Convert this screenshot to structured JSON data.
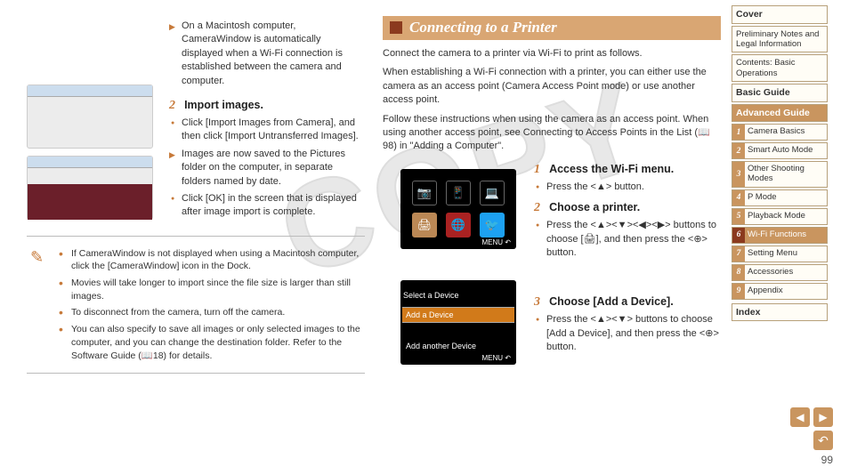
{
  "watermark": "COPY",
  "left": {
    "intro_play": "On a Macintosh computer, CameraWindow is automatically displayed when a Wi-Fi connection is established between the camera and computer.",
    "step2_num": "2",
    "step2_title": "Import images.",
    "step2_b1": "Click [Import Images from Camera], and then click [Import Untransferred Images].",
    "step2_b2": "Images are now saved to the Pictures folder on the computer, in separate folders named by date.",
    "step2_b3": "Click [OK] in the screen that is displayed after image import is complete.",
    "notes": [
      "If CameraWindow is not displayed when using a Macintosh computer, click the [CameraWindow] icon in the Dock.",
      "Movies will take longer to import since the file size is larger than still images.",
      "To disconnect from the camera, turn off the camera.",
      "You can also specify to save all images or only selected images to the computer, and you can change the destination folder. Refer to the Software Guide (📖18) for details."
    ]
  },
  "right": {
    "title": "Connecting to a Printer",
    "intro1": "Connect the camera to a printer via Wi-Fi to print as follows.",
    "intro2": "When establishing a Wi-Fi connection with a printer, you can either use the camera as an access point (Camera Access Point mode) or use another access point.",
    "intro3": "Follow these instructions when using the camera as an access point. When using another access point, see Connecting to Access Points in the List (📖98) in \"Adding a Computer\".",
    "step1_num": "1",
    "step1_title": "Access the Wi-Fi menu.",
    "step1_b1": "Press the <▲> button.",
    "step2_num": "2",
    "step2_title": "Choose a printer.",
    "step2_b1": "Press the <▲><▼><◀><▶> buttons to choose [🖨], and then press the <⊕> button.",
    "step3_num": "3",
    "step3_title": "Choose [Add a Device].",
    "step3_b1": "Press the <▲><▼> buttons to choose [Add a Device], and then press the <⊕> button.",
    "screen2": {
      "title": "Select a Device",
      "item_sel": "Add a Device",
      "item2": "Add another Device",
      "menu": "MENU ↶"
    },
    "screen1_menu": "MENU ↶"
  },
  "nav": {
    "cover": "Cover",
    "prelim": "Preliminary Notes and Legal Information",
    "contents": "Contents: Basic Operations",
    "basic": "Basic Guide",
    "advanced": "Advanced Guide",
    "items": [
      {
        "n": "1",
        "l": "Camera Basics"
      },
      {
        "n": "2",
        "l": "Smart Auto Mode"
      },
      {
        "n": "3",
        "l": "Other Shooting Modes"
      },
      {
        "n": "4",
        "l": "P Mode"
      },
      {
        "n": "5",
        "l": "Playback Mode"
      },
      {
        "n": "6",
        "l": "Wi-Fi Functions"
      },
      {
        "n": "7",
        "l": "Setting Menu"
      },
      {
        "n": "8",
        "l": "Accessories"
      },
      {
        "n": "9",
        "l": "Appendix"
      }
    ],
    "index": "Index"
  },
  "page_number": "99"
}
